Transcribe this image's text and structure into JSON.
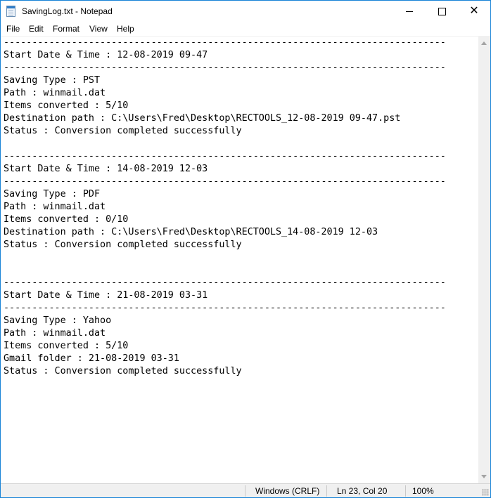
{
  "window": {
    "title": "SavingLog.txt - Notepad"
  },
  "menu": [
    "File",
    "Edit",
    "Format",
    "View",
    "Help"
  ],
  "document": {
    "text": "------------------------------------------------------------------------------\nStart Date & Time : 12-08-2019 09-47\n------------------------------------------------------------------------------\nSaving Type : PST\nPath : winmail.dat\nItems converted : 5/10\nDestination path : C:\\Users\\Fred\\Desktop\\RECTOOLS_12-08-2019 09-47.pst\nStatus : Conversion completed successfully\n\n------------------------------------------------------------------------------\nStart Date & Time : 14-08-2019 12-03\n------------------------------------------------------------------------------\nSaving Type : PDF\nPath : winmail.dat\nItems converted : 0/10\nDestination path : C:\\Users\\Fred\\Desktop\\RECTOOLS_14-08-2019 12-03\nStatus : Conversion completed successfully\n\n\n------------------------------------------------------------------------------\nStart Date & Time : 21-08-2019 03-31\n------------------------------------------------------------------------------\nSaving Type : Yahoo\nPath : winmail.dat\nItems converted : 5/10\nGmail folder : 21-08-2019 03-31\nStatus : Conversion completed successfully"
  },
  "status_bar": {
    "encoding": "Windows (CRLF)",
    "position": "Ln 23, Col 20",
    "zoom": "100%"
  },
  "icons": {
    "app": "notepad-icon",
    "minimize": "minimize-icon",
    "maximize": "maximize-icon",
    "close": "close-icon"
  }
}
